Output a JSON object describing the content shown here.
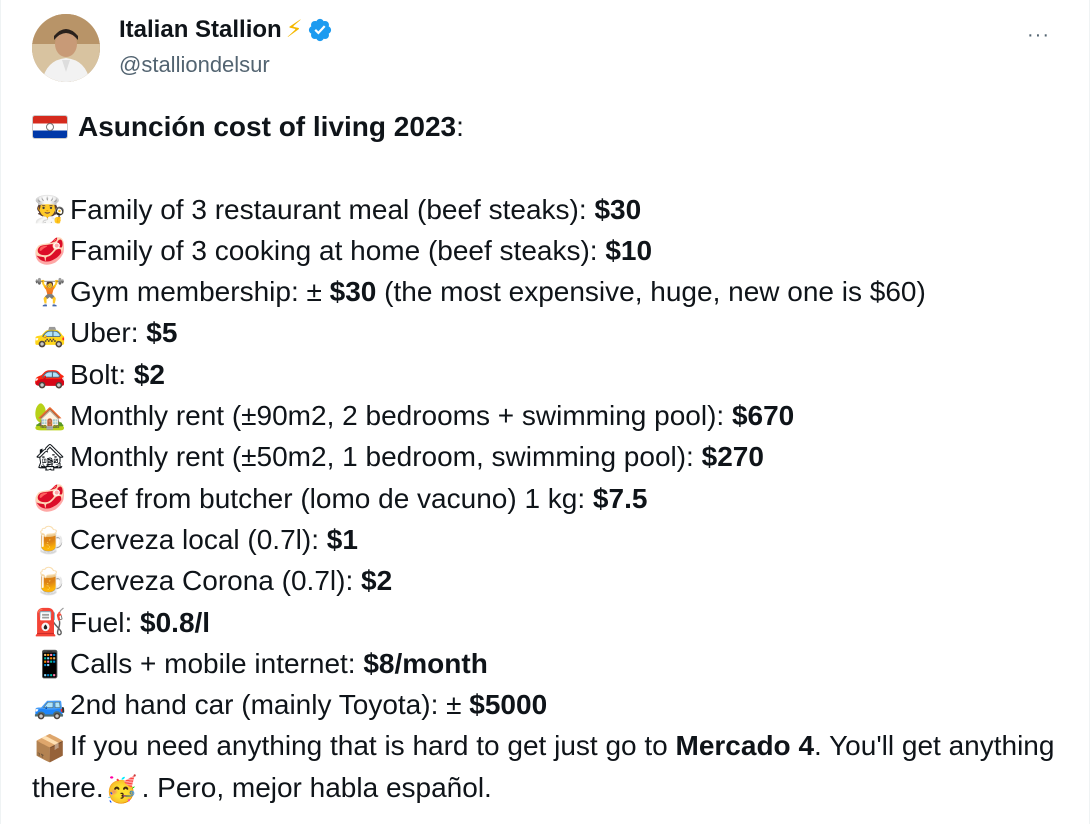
{
  "author": {
    "display_name": "Italian Stallion",
    "bolt_emoji": "⚡",
    "handle": "@stalliondelsur"
  },
  "header": {
    "more_label": "···"
  },
  "tweet": {
    "title_bold": "Asunción cost of living 2023",
    "title_suffix": ":",
    "items": [
      {
        "emoji": "🧑‍🍳",
        "text": "Family of 3 restaurant meal (beef steaks): ",
        "value": "$30",
        "after": ""
      },
      {
        "emoji": "🥩",
        "text": "Family of 3 cooking at home (beef steaks): ",
        "value": "$10",
        "after": ""
      },
      {
        "emoji": "🏋",
        "text": "Gym membership: ± ",
        "value": "$30",
        "after": " (the most expensive, huge, new one is $60)"
      },
      {
        "emoji": "🚕",
        "text": "Uber: ",
        "value": "$5",
        "after": ""
      },
      {
        "emoji": "🚗",
        "text": "Bolt: ",
        "value": "$2",
        "after": ""
      },
      {
        "emoji": "🏡",
        "text": "Monthly rent (±90m2, 2 bedrooms + swimming pool): ",
        "value": "$670",
        "after": ""
      },
      {
        "emoji": "🏚",
        "text": "Monthly rent (±50m2, 1 bedroom, swimming pool): ",
        "value": "$270",
        "after": ""
      },
      {
        "emoji": "🥩",
        "text": "Beef from butcher (lomo de vacuno) 1 kg: ",
        "value": "$7.5",
        "after": ""
      },
      {
        "emoji": "🍺",
        "text": "Cerveza local (0.7l): ",
        "value": "$1",
        "after": ""
      },
      {
        "emoji": "🍺",
        "text": "Cerveza Corona (0.7l): ",
        "value": "$2",
        "after": ""
      },
      {
        "emoji": "⛽",
        "text": "Fuel: ",
        "value": "$0.8/l",
        "after": ""
      },
      {
        "emoji": "📱",
        "text": "Calls + mobile internet: ",
        "value": "$8/month",
        "after": ""
      },
      {
        "emoji": "🚙",
        "text": "2nd hand car (mainly Toyota): ± ",
        "value": "$5000",
        "after": ""
      }
    ],
    "last": {
      "emoji": "📦",
      "text1": "If you need anything that is hard to get just go to ",
      "bold": "Mercado 4",
      "text2": ". You'll get anything there.",
      "emoji2": "🥳",
      "text3": ". Pero, mejor habla español."
    }
  },
  "colors": {
    "verified": "#1d9bf0",
    "text": "#0f1419",
    "muted": "#536471",
    "flag_red": "#d52b1e",
    "flag_blue": "#0038a8"
  }
}
